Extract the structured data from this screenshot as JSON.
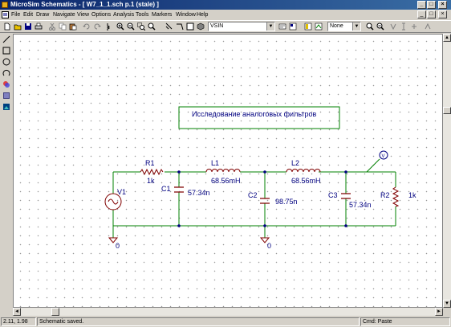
{
  "window": {
    "title": "MicroSim Schematics - [ W7_1_1.sch  p.1 (stale) ]",
    "min_glyph": "_",
    "max_glyph": "□",
    "close_glyph": "×"
  },
  "menu": [
    "File",
    "Edit",
    "Draw",
    "Navigate",
    "View",
    "Options",
    "Analysis",
    "Tools",
    "Markers",
    "Window",
    "Help"
  ],
  "toolbar": {
    "part_combo": "VSIN",
    "display_combo": "None"
  },
  "schematic": {
    "title_box": "Исследование аналоговых фильтров",
    "parts": {
      "r1": {
        "name": "R1",
        "value": "1k"
      },
      "l1": {
        "name": "L1",
        "value": "68.56mH"
      },
      "l2": {
        "name": "L2",
        "value": "68.56mH"
      },
      "c1": {
        "name": "C1",
        "value": "57.34n"
      },
      "c2": {
        "name": "C2",
        "value": "98.75n"
      },
      "c3": {
        "name": "C3",
        "value": "57.34n"
      },
      "r2": {
        "name": "R2",
        "value": "1k"
      },
      "v1": {
        "name": "V1"
      }
    },
    "ground_labels": [
      "0",
      "0"
    ],
    "marker": "V",
    "colors": {
      "wire": "#008000",
      "part": "#800000",
      "label": "#000080",
      "junction": "#000080"
    }
  },
  "status": {
    "coords": "2.11,   1.98",
    "message": "Schematic saved.",
    "cmd": "Cmd: Paste"
  },
  "icons": {
    "toolbar": [
      "new-icon",
      "open-icon",
      "save-icon",
      "print-icon",
      "cut-icon",
      "copy-icon",
      "paste-icon",
      "undo-icon",
      "redo-icon",
      "draw-wire-icon",
      "zoom-in-icon",
      "zoom-out-icon",
      "zoom-area-icon",
      "zoom-fit-icon",
      "redraw-icon",
      "place-wire-icon",
      "place-bus-icon",
      "place-block-icon",
      "get-part-icon",
      "edit-attributes-icon",
      "symbol-editor-icon",
      "probe-icon",
      "probe-voltage-icon",
      "probe-current-icon",
      "marker-v-icon",
      "marker-i-icon",
      "marker-db-icon"
    ],
    "left": [
      "draw-line-icon",
      "draw-box-icon",
      "draw-circle-icon",
      "draw-arc-icon",
      "draw-polyline-icon",
      "draw-text-icon",
      "insert-picture-icon"
    ]
  }
}
